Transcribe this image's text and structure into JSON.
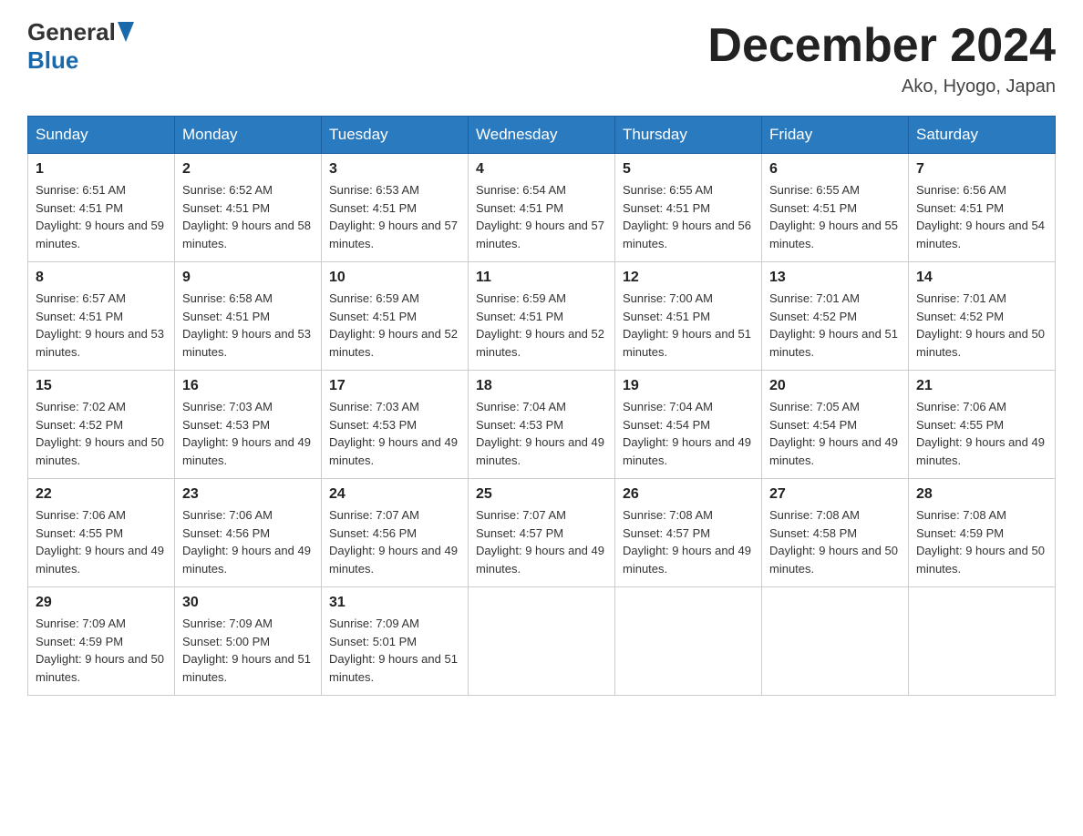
{
  "header": {
    "logo_general": "General",
    "logo_blue": "Blue",
    "month_title": "December 2024",
    "location": "Ako, Hyogo, Japan"
  },
  "weekdays": [
    "Sunday",
    "Monday",
    "Tuesday",
    "Wednesday",
    "Thursday",
    "Friday",
    "Saturday"
  ],
  "weeks": [
    [
      {
        "day": "1",
        "sunrise": "6:51 AM",
        "sunset": "4:51 PM",
        "daylight": "9 hours and 59 minutes."
      },
      {
        "day": "2",
        "sunrise": "6:52 AM",
        "sunset": "4:51 PM",
        "daylight": "9 hours and 58 minutes."
      },
      {
        "day": "3",
        "sunrise": "6:53 AM",
        "sunset": "4:51 PM",
        "daylight": "9 hours and 57 minutes."
      },
      {
        "day": "4",
        "sunrise": "6:54 AM",
        "sunset": "4:51 PM",
        "daylight": "9 hours and 57 minutes."
      },
      {
        "day": "5",
        "sunrise": "6:55 AM",
        "sunset": "4:51 PM",
        "daylight": "9 hours and 56 minutes."
      },
      {
        "day": "6",
        "sunrise": "6:55 AM",
        "sunset": "4:51 PM",
        "daylight": "9 hours and 55 minutes."
      },
      {
        "day": "7",
        "sunrise": "6:56 AM",
        "sunset": "4:51 PM",
        "daylight": "9 hours and 54 minutes."
      }
    ],
    [
      {
        "day": "8",
        "sunrise": "6:57 AM",
        "sunset": "4:51 PM",
        "daylight": "9 hours and 53 minutes."
      },
      {
        "day": "9",
        "sunrise": "6:58 AM",
        "sunset": "4:51 PM",
        "daylight": "9 hours and 53 minutes."
      },
      {
        "day": "10",
        "sunrise": "6:59 AM",
        "sunset": "4:51 PM",
        "daylight": "9 hours and 52 minutes."
      },
      {
        "day": "11",
        "sunrise": "6:59 AM",
        "sunset": "4:51 PM",
        "daylight": "9 hours and 52 minutes."
      },
      {
        "day": "12",
        "sunrise": "7:00 AM",
        "sunset": "4:51 PM",
        "daylight": "9 hours and 51 minutes."
      },
      {
        "day": "13",
        "sunrise": "7:01 AM",
        "sunset": "4:52 PM",
        "daylight": "9 hours and 51 minutes."
      },
      {
        "day": "14",
        "sunrise": "7:01 AM",
        "sunset": "4:52 PM",
        "daylight": "9 hours and 50 minutes."
      }
    ],
    [
      {
        "day": "15",
        "sunrise": "7:02 AM",
        "sunset": "4:52 PM",
        "daylight": "9 hours and 50 minutes."
      },
      {
        "day": "16",
        "sunrise": "7:03 AM",
        "sunset": "4:53 PM",
        "daylight": "9 hours and 49 minutes."
      },
      {
        "day": "17",
        "sunrise": "7:03 AM",
        "sunset": "4:53 PM",
        "daylight": "9 hours and 49 minutes."
      },
      {
        "day": "18",
        "sunrise": "7:04 AM",
        "sunset": "4:53 PM",
        "daylight": "9 hours and 49 minutes."
      },
      {
        "day": "19",
        "sunrise": "7:04 AM",
        "sunset": "4:54 PM",
        "daylight": "9 hours and 49 minutes."
      },
      {
        "day": "20",
        "sunrise": "7:05 AM",
        "sunset": "4:54 PM",
        "daylight": "9 hours and 49 minutes."
      },
      {
        "day": "21",
        "sunrise": "7:06 AM",
        "sunset": "4:55 PM",
        "daylight": "9 hours and 49 minutes."
      }
    ],
    [
      {
        "day": "22",
        "sunrise": "7:06 AM",
        "sunset": "4:55 PM",
        "daylight": "9 hours and 49 minutes."
      },
      {
        "day": "23",
        "sunrise": "7:06 AM",
        "sunset": "4:56 PM",
        "daylight": "9 hours and 49 minutes."
      },
      {
        "day": "24",
        "sunrise": "7:07 AM",
        "sunset": "4:56 PM",
        "daylight": "9 hours and 49 minutes."
      },
      {
        "day": "25",
        "sunrise": "7:07 AM",
        "sunset": "4:57 PM",
        "daylight": "9 hours and 49 minutes."
      },
      {
        "day": "26",
        "sunrise": "7:08 AM",
        "sunset": "4:57 PM",
        "daylight": "9 hours and 49 minutes."
      },
      {
        "day": "27",
        "sunrise": "7:08 AM",
        "sunset": "4:58 PM",
        "daylight": "9 hours and 50 minutes."
      },
      {
        "day": "28",
        "sunrise": "7:08 AM",
        "sunset": "4:59 PM",
        "daylight": "9 hours and 50 minutes."
      }
    ],
    [
      {
        "day": "29",
        "sunrise": "7:09 AM",
        "sunset": "4:59 PM",
        "daylight": "9 hours and 50 minutes."
      },
      {
        "day": "30",
        "sunrise": "7:09 AM",
        "sunset": "5:00 PM",
        "daylight": "9 hours and 51 minutes."
      },
      {
        "day": "31",
        "sunrise": "7:09 AM",
        "sunset": "5:01 PM",
        "daylight": "9 hours and 51 minutes."
      },
      null,
      null,
      null,
      null
    ]
  ]
}
